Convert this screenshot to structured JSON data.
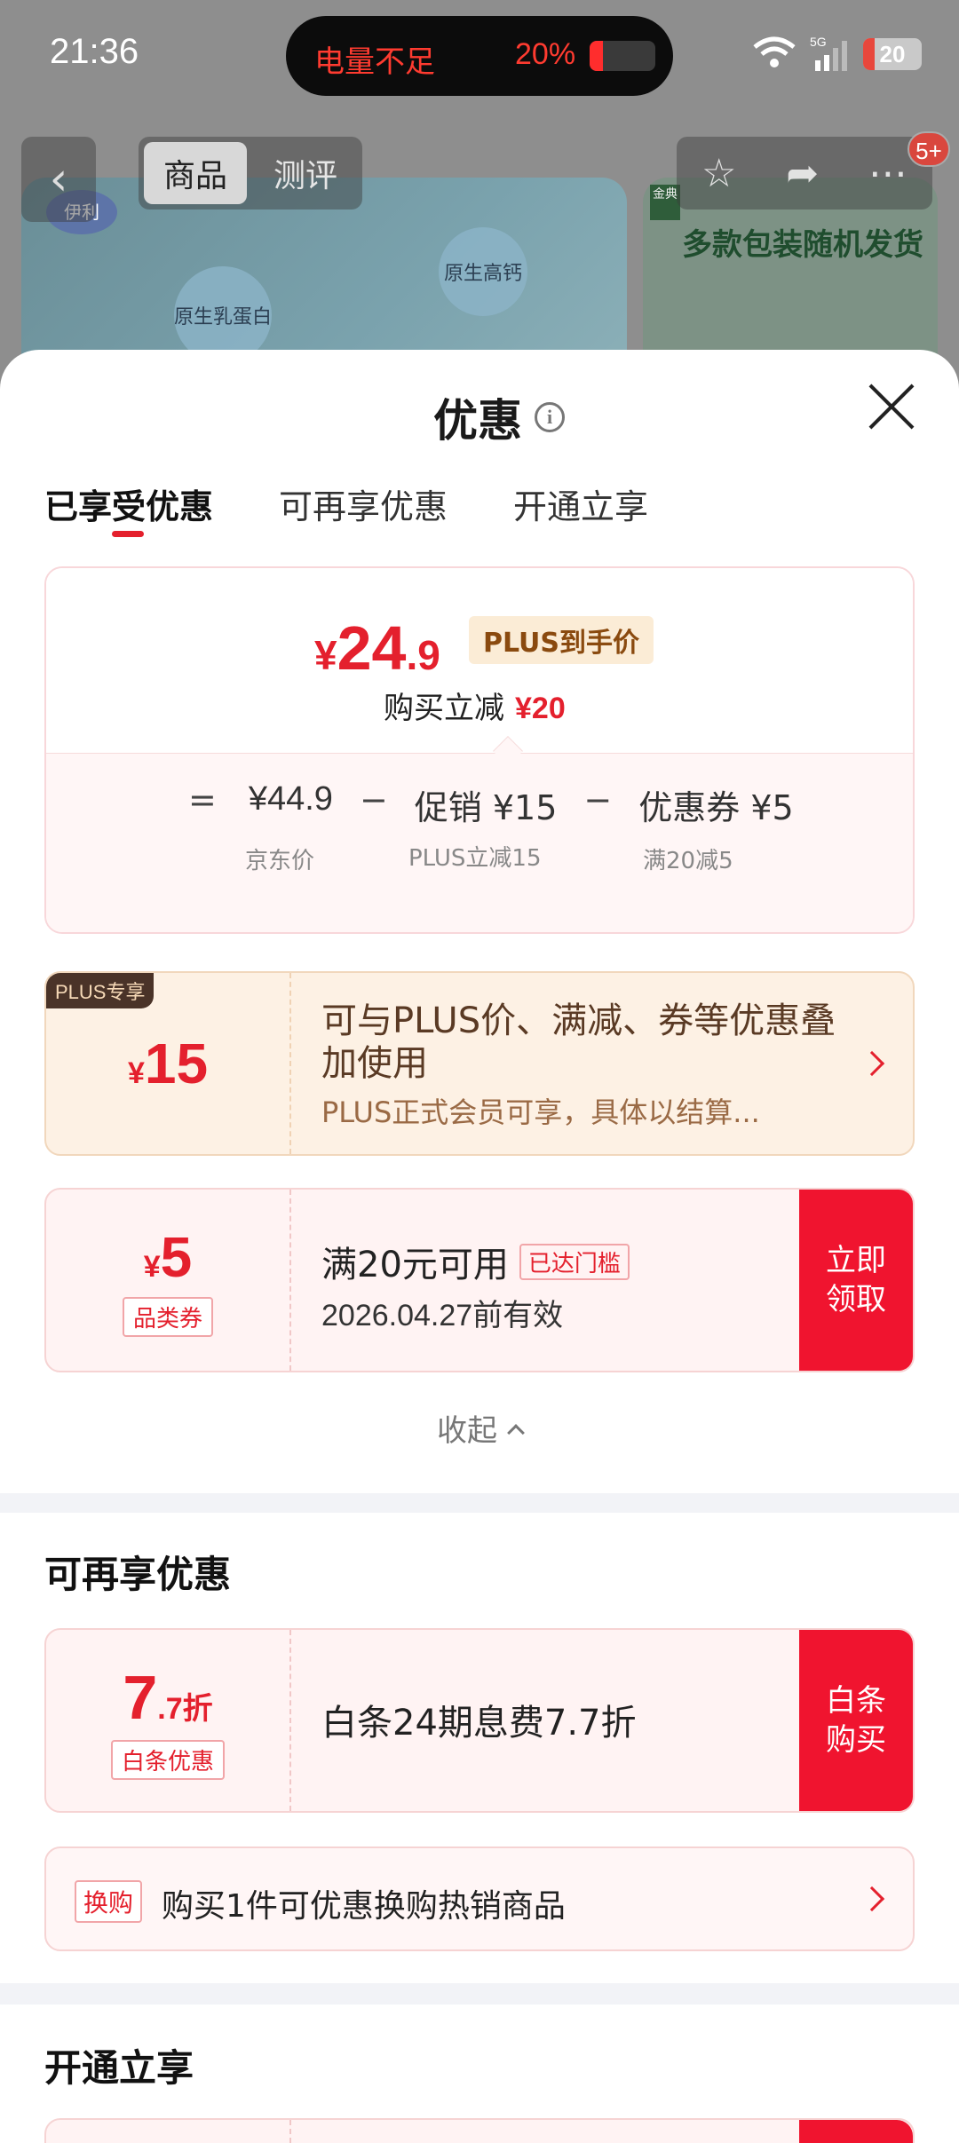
{
  "status_bar": {
    "time": "21:36",
    "battery_warning": "电量不足",
    "battery_pct": "20%",
    "battery_level": 0.2,
    "network": "5G",
    "battery_icon_value": "20",
    "icons": [
      "wifi-icon",
      "signal-icon",
      "battery-icon"
    ]
  },
  "header": {
    "tabs": [
      {
        "label": "商品",
        "active": true
      },
      {
        "label": "测评",
        "active": false
      }
    ],
    "badge": "5+",
    "banner_logo": "伊利",
    "banner_bubbles": [
      "原生乳蛋白",
      "原生高钙"
    ],
    "banner2_brand": "金典",
    "banner2_slogan": "多款包装随机发货"
  },
  "sheet": {
    "title": "优惠",
    "tabs": [
      {
        "label": "已享受优惠",
        "active": true
      },
      {
        "label": "可再享优惠",
        "active": false
      },
      {
        "label": "开通立享",
        "active": false
      }
    ]
  },
  "price_card": {
    "currency": "¥",
    "price_int": "24",
    "price_dec": ".9",
    "plus_label": "PLUS到手价",
    "save_text": "购买立减",
    "save_amount": "¥20",
    "formula": {
      "eq": "=",
      "jd_price": "¥44.9",
      "minus1": "−",
      "promo": "促销 ¥15",
      "minus2": "−",
      "coupon": "优惠券 ¥5"
    },
    "notes": {
      "jd_price": "京东价",
      "promo": "PLUS立减15",
      "coupon": "满20减5"
    }
  },
  "plus_coupon": {
    "tag": "PLUS专享",
    "currency": "¥",
    "amount": "15",
    "title": "可与PLUS价、满减、券等优惠叠加使用",
    "subtitle": "PLUS正式会员可享，具体以结算..."
  },
  "category_coupon": {
    "currency": "¥",
    "amount": "5",
    "type": "品类券",
    "title": "满20元可用",
    "reached": "已达门槛",
    "validity": "2026.04.27前有效",
    "button": "立即领取"
  },
  "collapse_label": "收起",
  "more_section": {
    "title": "可再享优惠",
    "baitiao": {
      "discount_int": "7",
      "discount_dec": ".7折",
      "tag": "白条优惠",
      "title": "白条24期息费7.7折",
      "button": "白条购买"
    },
    "swap": {
      "tag": "换购",
      "text": "购买1件可优惠换购热销商品"
    }
  },
  "open_section": {
    "title": "开通立享"
  },
  "colors": {
    "accent_red": "#e4202d",
    "button_red": "#f0142f",
    "plus_brown": "#4a3328"
  }
}
